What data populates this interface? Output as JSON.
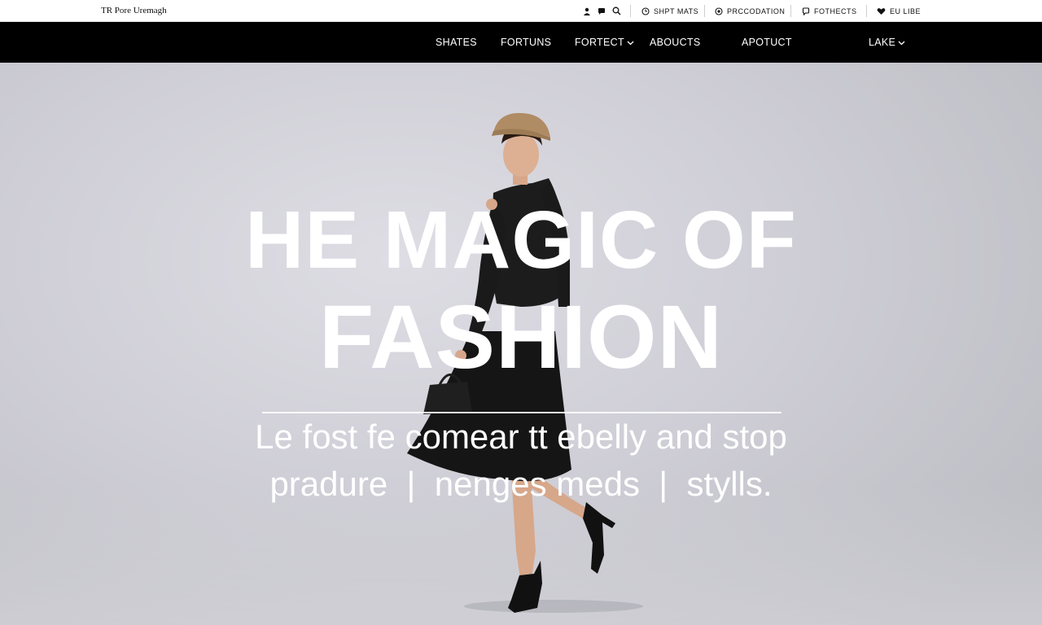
{
  "topbar": {
    "brand": "TR Pore Uremagh",
    "links": [
      {
        "label": "SHPT MATS",
        "icon": "clock-icon"
      },
      {
        "label": "PRCCODATION",
        "icon": "circle-dot-icon"
      },
      {
        "label": "FOTHECTS",
        "icon": "chat-icon"
      },
      {
        "label": "EU LIBE",
        "icon": "heart-icon"
      }
    ],
    "icons": [
      "user-icon",
      "chat-bubble-icon",
      "search-icon"
    ]
  },
  "nav": {
    "items": [
      {
        "label": "SHATES",
        "dropdown": false
      },
      {
        "label": "FORTUNS",
        "dropdown": false
      },
      {
        "label": "FORTECT",
        "dropdown": true
      },
      {
        "label": "ABOUCTS",
        "dropdown": false
      },
      {
        "label": "APOTUCT",
        "dropdown": false
      },
      {
        "label": "LAKE",
        "dropdown": true
      }
    ]
  },
  "hero": {
    "title_line1": "HE MAGIC OF",
    "title_line2": "FASHION",
    "subtitle_line1": "Le fost fe comear tt ebelly and stop",
    "subtitle_line2": "pradure  |  nenges meds  |  stylls."
  },
  "colors": {
    "nav_bg": "#000000",
    "topbar_bg": "#ffffff",
    "hero_bg": "#d2d1d8",
    "hero_text": "#ffffff"
  }
}
